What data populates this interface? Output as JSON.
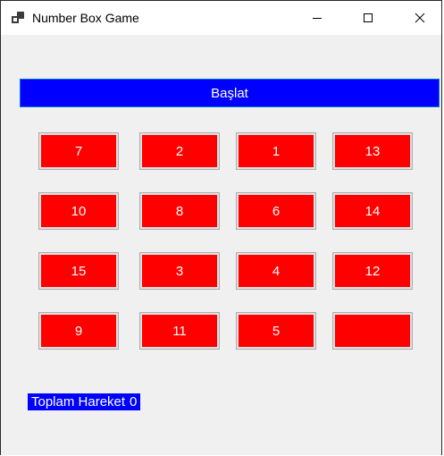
{
  "window": {
    "title": "Number Box Game"
  },
  "start_button": {
    "label": "Başlat",
    "color": "#0000ff"
  },
  "tiles": [
    [
      "7",
      "2",
      "1",
      "13"
    ],
    [
      "10",
      "8",
      "6",
      "14"
    ],
    [
      "15",
      "3",
      "4",
      "12"
    ],
    [
      "9",
      "11",
      "5",
      ""
    ]
  ],
  "tile_color": "#ff0000",
  "moves": {
    "label": "Toplam Hareket",
    "value": "0"
  },
  "icons": {
    "app": "app-window-icon",
    "minimize": "minimize-icon",
    "maximize": "maximize-icon",
    "close": "close-icon"
  }
}
